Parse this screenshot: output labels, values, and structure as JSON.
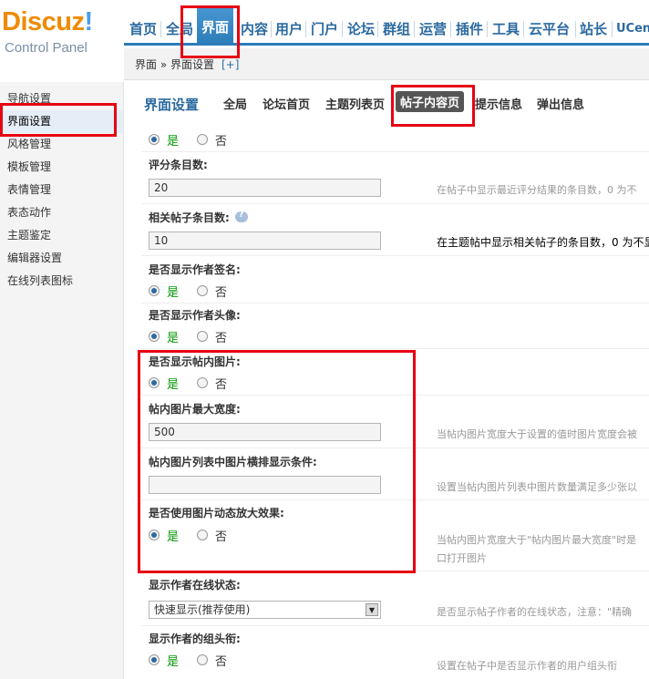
{
  "logo": {
    "title_main": "Discuz",
    "title_bang": "!",
    "subtitle": "Control Panel"
  },
  "nav": {
    "items": [
      "首页",
      "全局",
      "界面",
      "内容",
      "用户",
      "门户",
      "论坛",
      "群组",
      "运营",
      "插件",
      "工具",
      "云平台",
      "站长",
      "UCen"
    ],
    "active_index": 2
  },
  "breadcrumb": {
    "path": "界面 » 界面设置",
    "add": "[+]"
  },
  "sidebar": {
    "items": [
      "导航设置",
      "界面设置",
      "风格管理",
      "模板管理",
      "表情管理",
      "表态动作",
      "主题鉴定",
      "编辑器设置",
      "在线列表图标"
    ],
    "active_index": 1
  },
  "tabs": {
    "title": "界面设置",
    "items": [
      "全局",
      "论坛首页",
      "主题列表页",
      "帖子内容页",
      "提示信息",
      "弹出信息"
    ],
    "active_index": 3
  },
  "form": {
    "yes": "是",
    "no": "否",
    "rate_count": {
      "label": "评分条目数:",
      "value": "20",
      "desc": "在帖子中显示最近评分结果的条目数，0 为不"
    },
    "related_count": {
      "label": "相关帖子条目数:",
      "value": "10",
      "desc": "在主题帖中显示相关帖子的条目数，0 为不显"
    },
    "show_signature": {
      "label": "是否显示作者签名:"
    },
    "show_avatar": {
      "label": "是否显示作者头像:"
    },
    "show_images": {
      "label": "是否显示帖内图片:"
    },
    "image_max_width": {
      "label": "帖内图片最大宽度:",
      "value": "500",
      "desc": "当帖内图片宽度大于设置的值时图片宽度会被"
    },
    "image_list_cond": {
      "label": "帖内图片列表中图片横排显示条件:",
      "value": "",
      "desc": "设置当帖内图片列表中图片数量满足多少张以"
    },
    "image_zoom": {
      "label": "是否使用图片动态放大效果:",
      "desc_line1": "当帖内图片宽度大于\"帖内图片最大宽度\"时是",
      "desc_line2": "口打开图片"
    },
    "online_status": {
      "label": "显示作者在线状态:",
      "selected": "快速显示(推荐使用)",
      "desc": "是否显示帖子作者的在线状态，注意：\"精确"
    },
    "group_title": {
      "label": "显示作者的组头衔:",
      "desc": "设置在帖子中是否显示作者的用户组头衔"
    }
  },
  "colors": {
    "accent": "#2b7cb9",
    "highlight": "#e60012",
    "logo_orange": "#f08a00",
    "logo_blue": "#4a9ee8",
    "yes_green": "#009900"
  }
}
